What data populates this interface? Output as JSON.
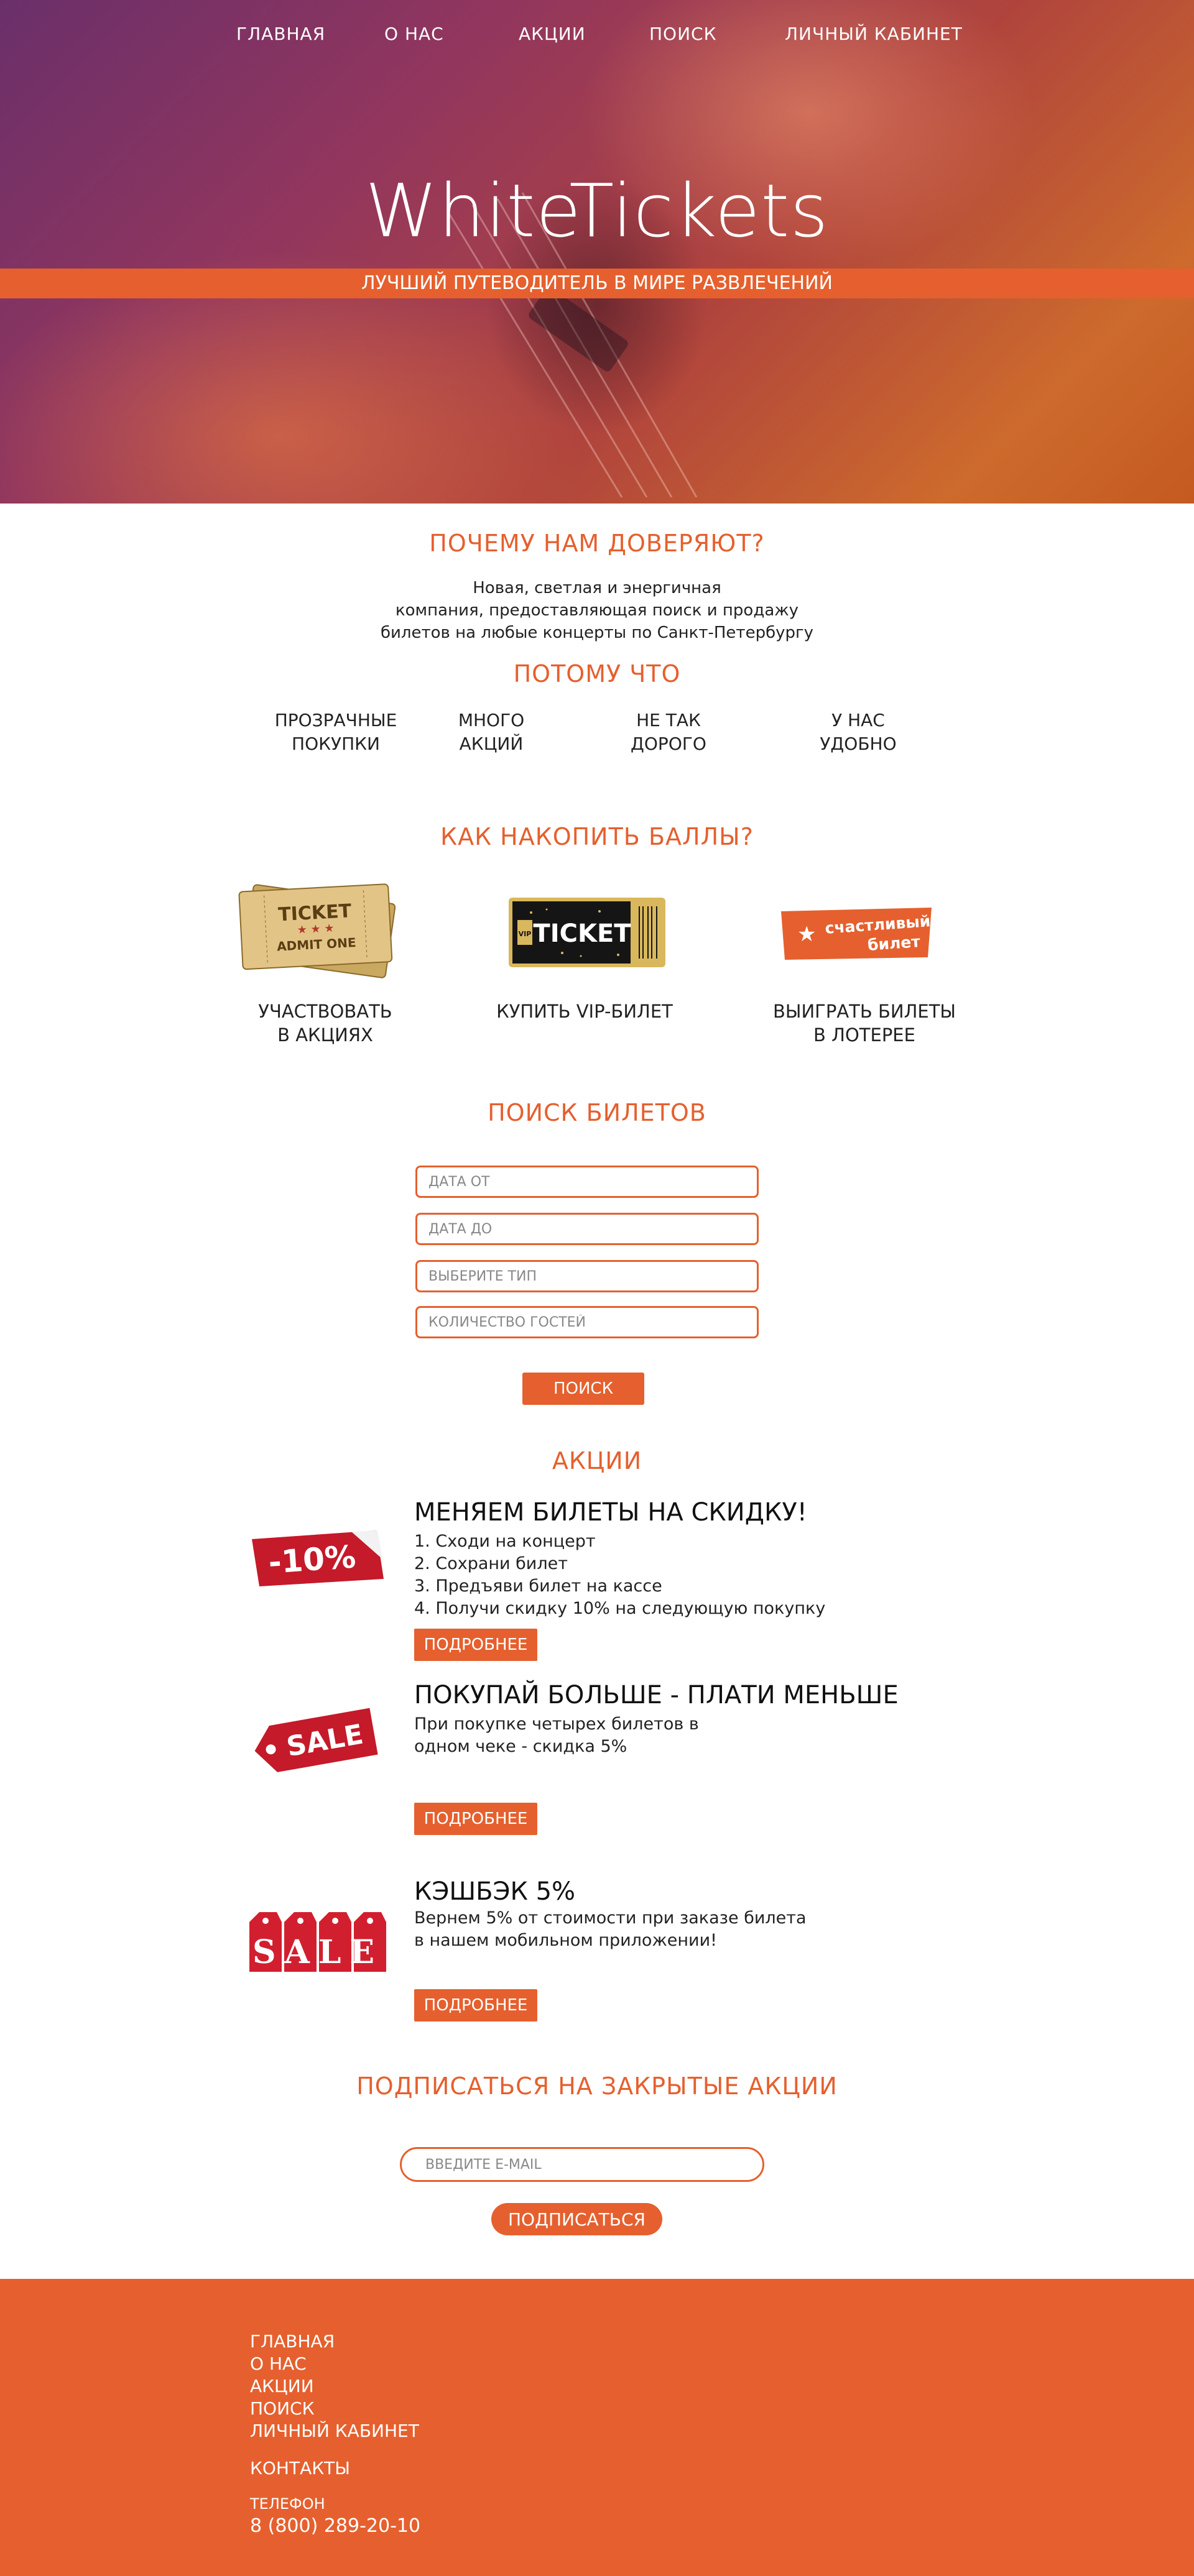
{
  "nav": {
    "items": [
      {
        "label": "ГЛАВНАЯ"
      },
      {
        "label": "О НАС"
      },
      {
        "label": "АКЦИИ"
      },
      {
        "label": "ПОИСК"
      },
      {
        "label": "ЛИЧНЫЙ КАБИНЕТ"
      }
    ]
  },
  "hero": {
    "brand": "WhiteTickets",
    "tagline": "ЛУЧШИЙ ПУТЕВОДИТЕЛЬ В МИРЕ РАЗВЛЕЧЕНИЙ"
  },
  "trust": {
    "title": "ПОЧЕМУ НАМ ДОВЕРЯЮТ?",
    "lines": [
      "Новая, светлая и энергичная",
      "компания, предоставляющая поиск и продажу",
      "билетов на любые концерты по Санкт-Петербургу"
    ],
    "because_title": "ПОТОМУ ЧТО",
    "reasons": [
      {
        "line1": "ПРОЗРАЧНЫЕ",
        "line2": "ПОКУПКИ"
      },
      {
        "line1": "МНОГО",
        "line2": "АКЦИЙ"
      },
      {
        "line1": "НЕ ТАК",
        "line2": "ДОРОГО"
      },
      {
        "line1": "У НАС",
        "line2": "УДОБНО"
      }
    ]
  },
  "points": {
    "title": "КАК НАКОПИТЬ БАЛЛЫ?",
    "items": [
      {
        "line1": "УЧАСТВОВАТЬ",
        "line2": "В АКЦИЯХ",
        "img_text": "TICKET",
        "img_sub": "ADMIT ONE"
      },
      {
        "line1": "КУПИТЬ VIP-БИЛЕТ",
        "line2": "",
        "img_text": "TICKET",
        "img_sub": "VIP"
      },
      {
        "line1": "ВЫИГРАТЬ БИЛЕТЫ",
        "line2": "В ЛОТЕРЕЕ",
        "img_text": "счастливый",
        "img_sub": "билет"
      }
    ]
  },
  "search": {
    "title": "ПОИСК БИЛЕТОВ",
    "date_from": "ДАТА ОТ",
    "date_to": "ДАТА ДО",
    "type": "ВЫБЕРИТЕ ТИП",
    "guests": "КОЛИЧЕСТВО ГОСТЕЙ",
    "button": "ПОИСК"
  },
  "promos": {
    "title": "АКЦИИ",
    "more_label": "ПОДРОБНЕЕ",
    "items": [
      {
        "title": "МЕНЯЕМ БИЛЕТЫ НА СКИДКУ!",
        "badge": "-10%",
        "lines": [
          "1. Сходи на концерт",
          "2. Сохрани билет",
          "3. Предъяви билет на кассе",
          "4. Получи скидку 10% на следующую покупку"
        ]
      },
      {
        "title": "ПОКУПАЙ БОЛЬШЕ - ПЛАТИ МЕНЬШЕ",
        "badge": "SALE",
        "lines": [
          "При покупке четырех билетов в",
          "одном чеке - скидка 5%"
        ]
      },
      {
        "title": "КЭШБЭК 5%",
        "badge": "SALE",
        "lines": [
          "Вернем 5% от стоимости при заказе билета",
          "в нашем мобильном приложении!"
        ]
      }
    ]
  },
  "subscribe": {
    "title": "ПОДПИСАТЬСЯ НА ЗАКРЫТЫЕ АКЦИИ",
    "placeholder": "ВВЕДИТЕ E-MAIL",
    "button": "ПОДПИСАТЬСЯ"
  },
  "footer": {
    "links": [
      {
        "label": "ГЛАВНАЯ"
      },
      {
        "label": "О НАС"
      },
      {
        "label": "АКЦИИ"
      },
      {
        "label": "ПОИСК"
      },
      {
        "label": "ЛИЧНЫЙ КАБИНЕТ"
      }
    ],
    "contacts_title": "КОНТАКТЫ",
    "phone_label": "ТЕЛЕФОН",
    "phone": "8 (800) 289-20-10"
  },
  "colors": {
    "accent": "#e5602e",
    "text": "#222222",
    "background": "#ffffff"
  }
}
